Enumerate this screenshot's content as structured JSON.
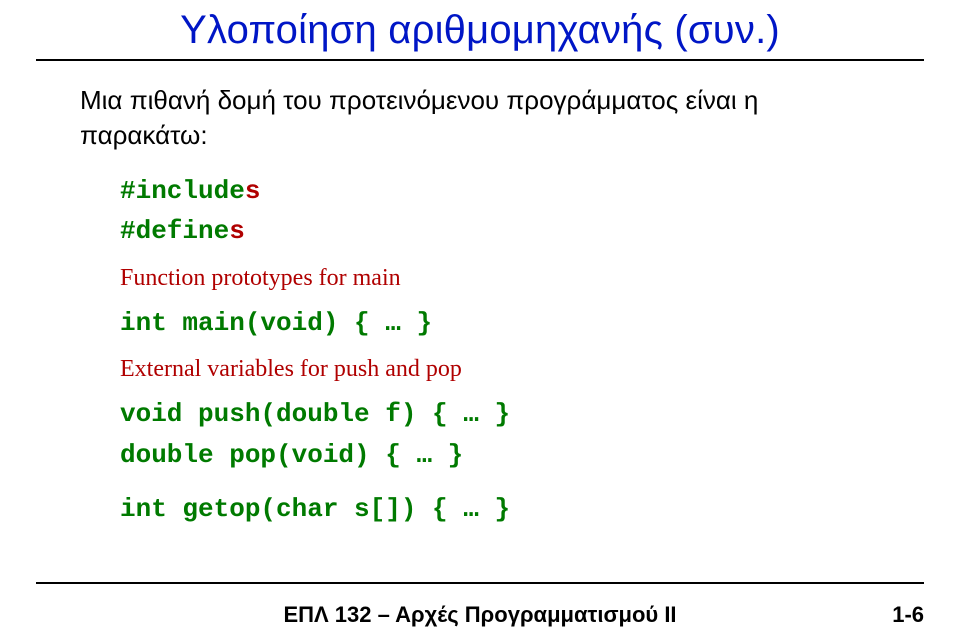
{
  "title": "Υλοποίηση αριθμομηχανής (συν.)",
  "intro_line1": "Μια πιθανή δομή του προτεινόμενου προγράμματος είναι η",
  "intro_line2": "παρακάτω:",
  "code": {
    "include_kw": "#include",
    "include_suffix": "s",
    "define_kw": "#define",
    "define_suffix": "s",
    "proto_comment": "Function prototypes for main",
    "main_sig": "int main(void) { … }",
    "ext_comment": "External variables for push and pop",
    "push_sig": "void push(double f) { … }",
    "pop_sig": "double pop(void) { … }",
    "getop_sig": "int getop(char s[]) { … }"
  },
  "footer": "ΕΠΛ 132 – Αρχές Προγραμματισμού ΙΙ",
  "page": "1-6"
}
